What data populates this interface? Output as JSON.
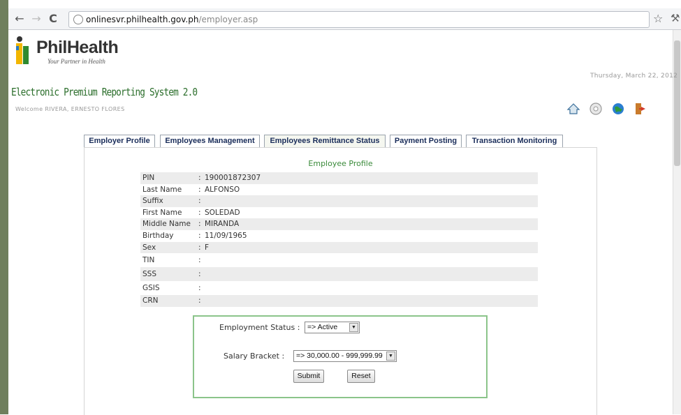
{
  "browser": {
    "url_host": "onlinesvr.philhealth.gov.ph",
    "url_path": "/employer.asp"
  },
  "header": {
    "logo_text": "PhilHealth",
    "logo_tagline": "Your Partner in Health",
    "date": "Thursday, March 22, 2012",
    "system_title": "Electronic Premium Reporting System 2.0",
    "welcome": "Welcome RIVERA, ERNESTO FLORES",
    "icons": [
      "home-icon",
      "settings-icon",
      "globe-icon",
      "logout-icon"
    ]
  },
  "tabs": [
    {
      "label": "Employer Profile"
    },
    {
      "label": "Employees Management"
    },
    {
      "label": "Employees Remittance Status"
    },
    {
      "label": "Payment Posting"
    },
    {
      "label": "Transaction Monitoring"
    }
  ],
  "profile": {
    "title": "Employee Profile",
    "fields": [
      {
        "label": "PIN",
        "value": "190001872307"
      },
      {
        "label": "Last Name",
        "value": "ALFONSO"
      },
      {
        "label": "Suffix",
        "value": ""
      },
      {
        "label": "First Name",
        "value": "SOLEDAD"
      },
      {
        "label": "Middle Name",
        "value": "MIRANDA"
      },
      {
        "label": "Birthday",
        "value": "11/09/1965"
      },
      {
        "label": "Sex",
        "value": "F"
      },
      {
        "label": "TIN",
        "value": ""
      },
      {
        "label": "SSS",
        "value": ""
      },
      {
        "label": "GSIS",
        "value": ""
      },
      {
        "label": "CRN",
        "value": ""
      }
    ]
  },
  "form": {
    "employment_status_label": "Employment Status :",
    "employment_status_value": "=> Active",
    "salary_bracket_label": "Salary Bracket :",
    "salary_bracket_value": "=> 30,000.00 - 999,999.99",
    "submit_label": "Submit",
    "reset_label": "Reset"
  },
  "colors": {
    "accent_green": "#3a8a3a",
    "tab_text": "#1a2d5a",
    "form_border": "#8bc48a"
  }
}
